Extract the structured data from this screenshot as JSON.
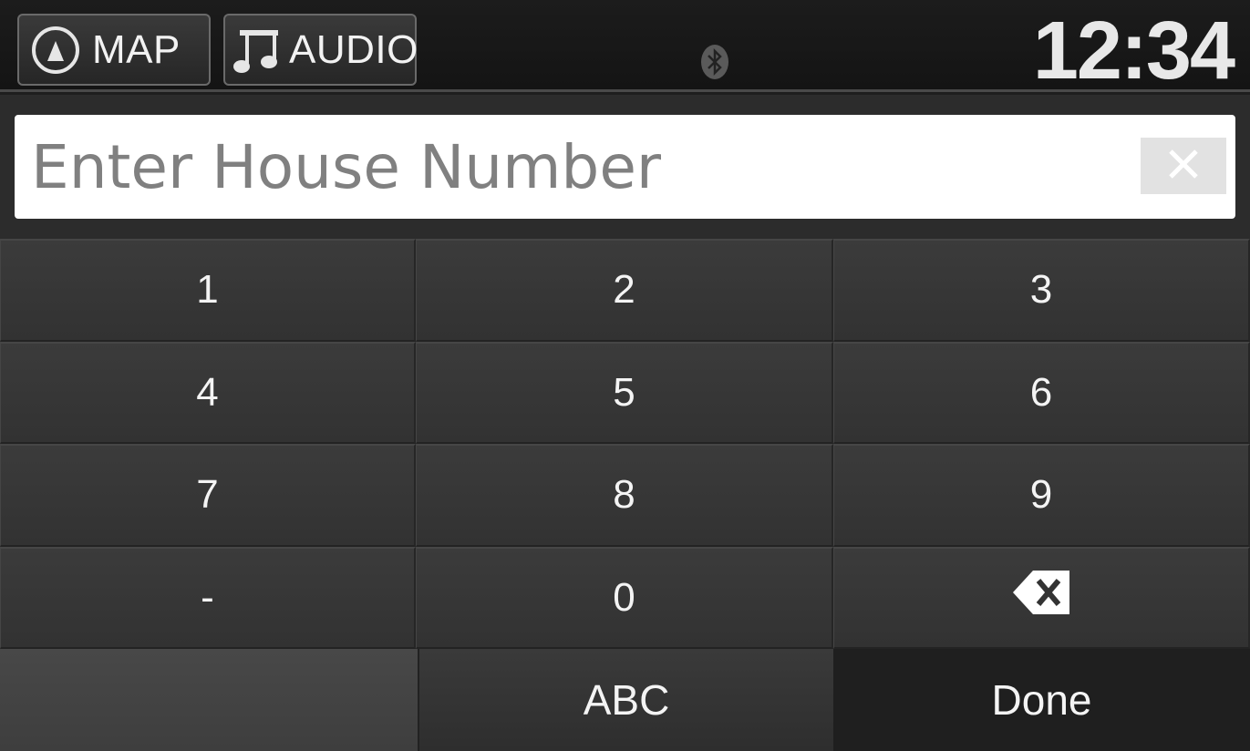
{
  "header": {
    "map_label": "MAP",
    "audio_label": "AUDIO",
    "clock": "12:34"
  },
  "input": {
    "placeholder": "Enter House Number",
    "value": ""
  },
  "keypad": {
    "keys": [
      "1",
      "2",
      "3",
      "4",
      "5",
      "6",
      "7",
      "8",
      "9",
      "-",
      "0"
    ]
  },
  "actions": {
    "abc_label": "ABC",
    "done_label": "Done"
  },
  "icons": {
    "map": "compass-arrow-icon",
    "audio": "music-note-icon",
    "bluetooth": "bluetooth-icon",
    "clear": "close-icon",
    "backspace": "backspace-icon"
  }
}
